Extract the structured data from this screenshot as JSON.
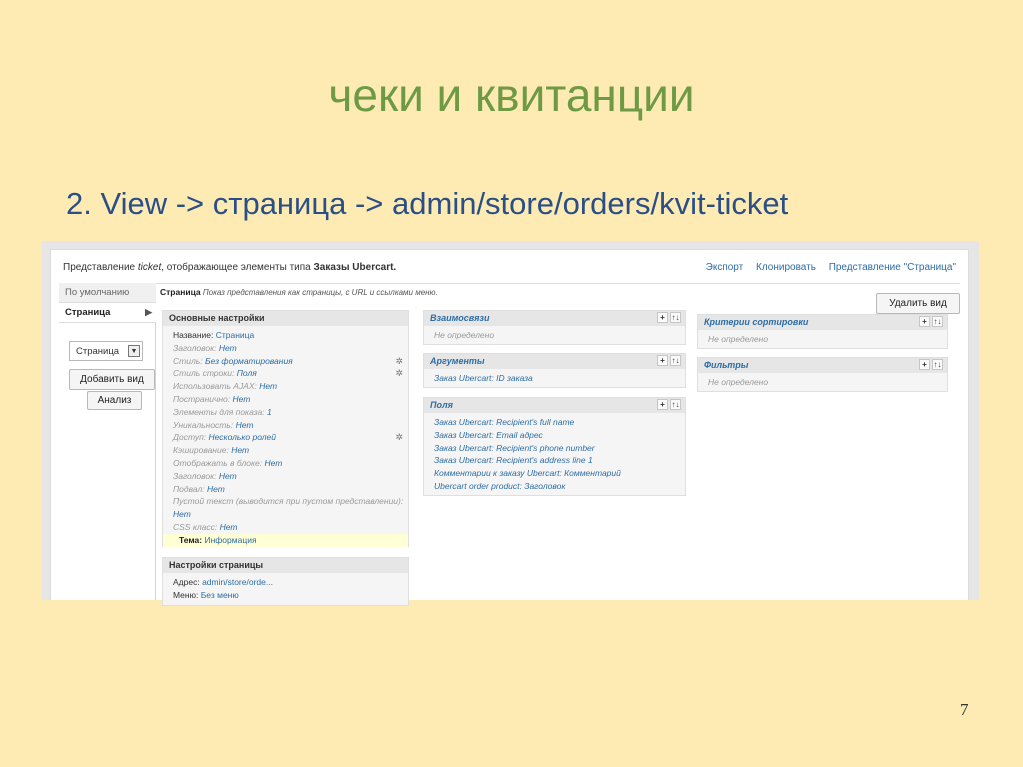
{
  "slide": {
    "title": "чеки и квитанции",
    "subtitle": "2. View -> страница -> admin/store/orders/kvit-ticket",
    "page_number": "7"
  },
  "view": {
    "desc_prefix": "Представление",
    "desc_name": "ticket",
    "desc_middle": ", отображающее элементы типа",
    "desc_type": "Заказы Ubercart.",
    "links": [
      "Экспорт",
      "Клонировать",
      "Представление \"Страница\""
    ]
  },
  "sidebar": {
    "tab_default": "По умолчанию",
    "tab_page": "Страница",
    "tab_arrow": "▶",
    "select_value": "Страница",
    "add_view_label": "Добавить вид",
    "analysis_label": "Анализ"
  },
  "strip": {
    "label": "Страница",
    "hint": "Показ представления как страницы, с URL и ссылками меню."
  },
  "delete_label": "Удалить вид",
  "basic_settings": {
    "title": "Основные настройки",
    "rows": [
      {
        "k": "Название:",
        "v": "Страница",
        "dim": false,
        "gear": false
      },
      {
        "k": "Заголовок:",
        "v": "Нет",
        "dim": true,
        "gear": false
      },
      {
        "k": "Стиль:",
        "v": "Без форматирования",
        "dim": true,
        "gear": true
      },
      {
        "k": "Стиль строки:",
        "v": "Поля",
        "dim": true,
        "gear": true
      },
      {
        "k": "Использовать AJAX:",
        "v": "Нет",
        "dim": true,
        "gear": false
      },
      {
        "k": "Постранично:",
        "v": "Нет",
        "dim": true,
        "gear": false
      },
      {
        "k": "Элементы для показа:",
        "v": "1",
        "dim": true,
        "gear": false
      },
      {
        "k": "Уникальность:",
        "v": "Нет",
        "dim": true,
        "gear": false
      },
      {
        "k": "Доступ:",
        "v": "Несколько ролей",
        "dim": true,
        "gear": true
      },
      {
        "k": "Кэширование:",
        "v": "Нет",
        "dim": true,
        "gear": false
      },
      {
        "k": "Отображать в блоке:",
        "v": "Нет",
        "dim": true,
        "gear": false
      },
      {
        "k": "Заголовок:",
        "v": "Нет",
        "dim": true,
        "gear": false
      },
      {
        "k": "Подвал:",
        "v": "Нет",
        "dim": true,
        "gear": false
      },
      {
        "k": "Пустой текст (выводится при пустом представлении):",
        "v": "",
        "dim": true,
        "gear": false
      },
      {
        "k": "",
        "v": "Нет",
        "dim": true,
        "gear": false
      },
      {
        "k": "CSS класс:",
        "v": "Нет",
        "dim": true,
        "gear": false
      }
    ],
    "theme_key": "Тема:",
    "theme_value": "Информация"
  },
  "page_settings": {
    "title": "Настройки страницы",
    "address_key": "Адрес:",
    "address_value": "admin/store/orde...",
    "menu_key": "Меню:",
    "menu_value": "Без меню"
  },
  "relationships": {
    "title": "Взаимосвязи",
    "empty": "Не определено"
  },
  "arguments": {
    "title": "Аргументы",
    "item": "Заказ Ubercart: ID заказа"
  },
  "fields": {
    "title": "Поля",
    "items": [
      "Заказ Ubercart: Recipient's full name",
      "Заказ Ubercart: Email адрес",
      "Заказ Ubercart: Recipient's phone number",
      "Заказ Ubercart: Recipient's address line 1",
      "Комментарии к заказу Ubercart: Комментарий",
      "Ubercart order product: Заголовок"
    ]
  },
  "sort": {
    "title": "Критерии сортировки",
    "empty": "Не определено"
  },
  "filters": {
    "title": "Фильтры",
    "empty": "Не определено"
  },
  "tools": {
    "add": "+",
    "rearrange": "↑↓"
  },
  "icons": {
    "gear": "gear-icon",
    "plus": "plus-icon",
    "rearrange": "rearrange-icon",
    "dropdown": "chevron-down-icon"
  }
}
